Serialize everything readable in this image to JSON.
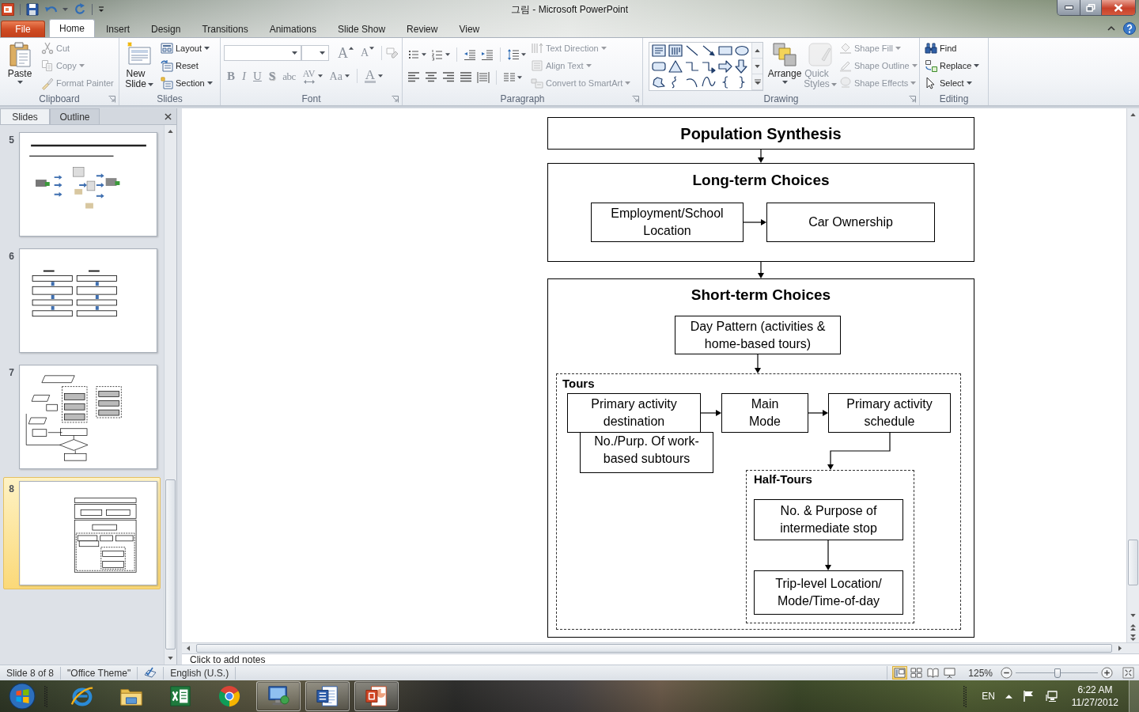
{
  "window": {
    "title": "그림 - Microsoft PowerPoint"
  },
  "ribbon_tabs": [
    {
      "label": "File",
      "kind": "file",
      "selected": false
    },
    {
      "label": "Home",
      "kind": "tab",
      "selected": true
    },
    {
      "label": "Insert",
      "kind": "tab",
      "selected": false
    },
    {
      "label": "Design",
      "kind": "tab",
      "selected": false
    },
    {
      "label": "Transitions",
      "kind": "tab",
      "selected": false
    },
    {
      "label": "Animations",
      "kind": "tab",
      "selected": false
    },
    {
      "label": "Slide Show",
      "kind": "tab",
      "selected": false
    },
    {
      "label": "Review",
      "kind": "tab",
      "selected": false
    },
    {
      "label": "View",
      "kind": "tab",
      "selected": false
    }
  ],
  "ribbon": {
    "clipboard": {
      "label": "Clipboard",
      "paste": {
        "label": "Paste",
        "disabled": false
      },
      "small": [
        {
          "label": "Cut",
          "disabled": true
        },
        {
          "label": "Copy",
          "disabled": true
        },
        {
          "label": "Format Painter",
          "disabled": true
        }
      ]
    },
    "slides": {
      "label": "Slides",
      "new_slide": {
        "label": "New Slide",
        "disabled": false
      },
      "small": [
        {
          "label": "Layout",
          "disabled": false
        },
        {
          "label": "Reset",
          "disabled": false
        },
        {
          "label": "Section",
          "disabled": false
        }
      ]
    },
    "font": {
      "label": "Font",
      "size_buttons": [
        {
          "label": "A",
          "kind": "grow",
          "disabled": true
        },
        {
          "label": "A",
          "kind": "shrink",
          "disabled": true
        }
      ],
      "format_buttons": [
        {
          "label": "B",
          "kind": "bold",
          "disabled": true
        },
        {
          "label": "I",
          "kind": "italic",
          "disabled": true
        },
        {
          "label": "U",
          "kind": "underline",
          "disabled": true
        },
        {
          "label": "S",
          "kind": "shadow",
          "disabled": true
        },
        {
          "label": "abc",
          "kind": "strike",
          "disabled": true
        },
        {
          "label": "AV",
          "kind": "spacing",
          "disabled": true
        },
        {
          "label": "Aa",
          "kind": "case",
          "disabled": true
        },
        {
          "label": "A",
          "kind": "color",
          "disabled": true
        }
      ]
    },
    "paragraph": {
      "label": "Paragraph",
      "small": [
        {
          "label": "Text Direction",
          "disabled": true
        },
        {
          "label": "Align Text",
          "disabled": true
        },
        {
          "label": "Convert to SmartArt",
          "disabled": true
        }
      ]
    },
    "drawing": {
      "label": "Drawing",
      "arrange": {
        "label": "Arrange",
        "disabled": false
      },
      "quick_styles": {
        "label": "Quick Styles",
        "disabled": true
      },
      "small": [
        {
          "label": "Shape Fill",
          "disabled": true
        },
        {
          "label": "Shape Outline",
          "disabled": true
        },
        {
          "label": "Shape Effects",
          "disabled": true
        }
      ]
    },
    "editing": {
      "label": "Editing",
      "small": [
        {
          "label": "Find",
          "disabled": false
        },
        {
          "label": "Replace",
          "disabled": false
        },
        {
          "label": "Select",
          "disabled": false
        }
      ]
    }
  },
  "slide_pane": {
    "tabs": [
      {
        "label": "Slides",
        "selected": true
      },
      {
        "label": "Outline",
        "selected": false
      }
    ],
    "slides": [
      {
        "number": "5",
        "selected": false
      },
      {
        "number": "6",
        "selected": false
      },
      {
        "number": "7",
        "selected": false
      },
      {
        "number": "8",
        "selected": true
      }
    ]
  },
  "diagram": {
    "population": {
      "label": "Population Synthesis"
    },
    "long_term": {
      "title": "Long-term Choices",
      "boxes": [
        {
          "label": "Employment/School Location"
        },
        {
          "label": "Car Ownership"
        }
      ]
    },
    "short_term": {
      "title": "Short-term Choices",
      "day_pattern": {
        "label": "Day Pattern (activities & home-based tours)"
      },
      "tours": {
        "title": "Tours",
        "boxes": [
          {
            "label": "Primary activity destination"
          },
          {
            "label": "No./Purp. Of work-based subtours"
          },
          {
            "label": "Main Mode"
          },
          {
            "label": "Primary activity schedule"
          }
        ],
        "half_tours": {
          "title": "Half-Tours",
          "boxes": [
            {
              "label": "No. & Purpose of intermediate stop"
            },
            {
              "label": "Trip-level Location/ Mode/Time-of-day"
            }
          ]
        }
      }
    }
  },
  "notes": {
    "placeholder": "Click to add notes"
  },
  "status_bar": {
    "slide_indicator": "Slide 8 of 8",
    "theme": "\"Office Theme\"",
    "language": "English (U.S.)",
    "views": [
      {
        "selected": true
      },
      {
        "selected": false
      },
      {
        "selected": false
      },
      {
        "selected": false
      }
    ],
    "zoom": "125%",
    "zoom_slider": {
      "level": 0.51
    }
  },
  "taskbar": {
    "apps": [
      {
        "running": false
      },
      {
        "running": false
      },
      {
        "running": false
      },
      {
        "running": false
      },
      {
        "running": true
      },
      {
        "running": true
      },
      {
        "running": true
      }
    ],
    "tray": {
      "language": "EN",
      "time": "6:22 AM",
      "date": "11/27/2012"
    }
  }
}
